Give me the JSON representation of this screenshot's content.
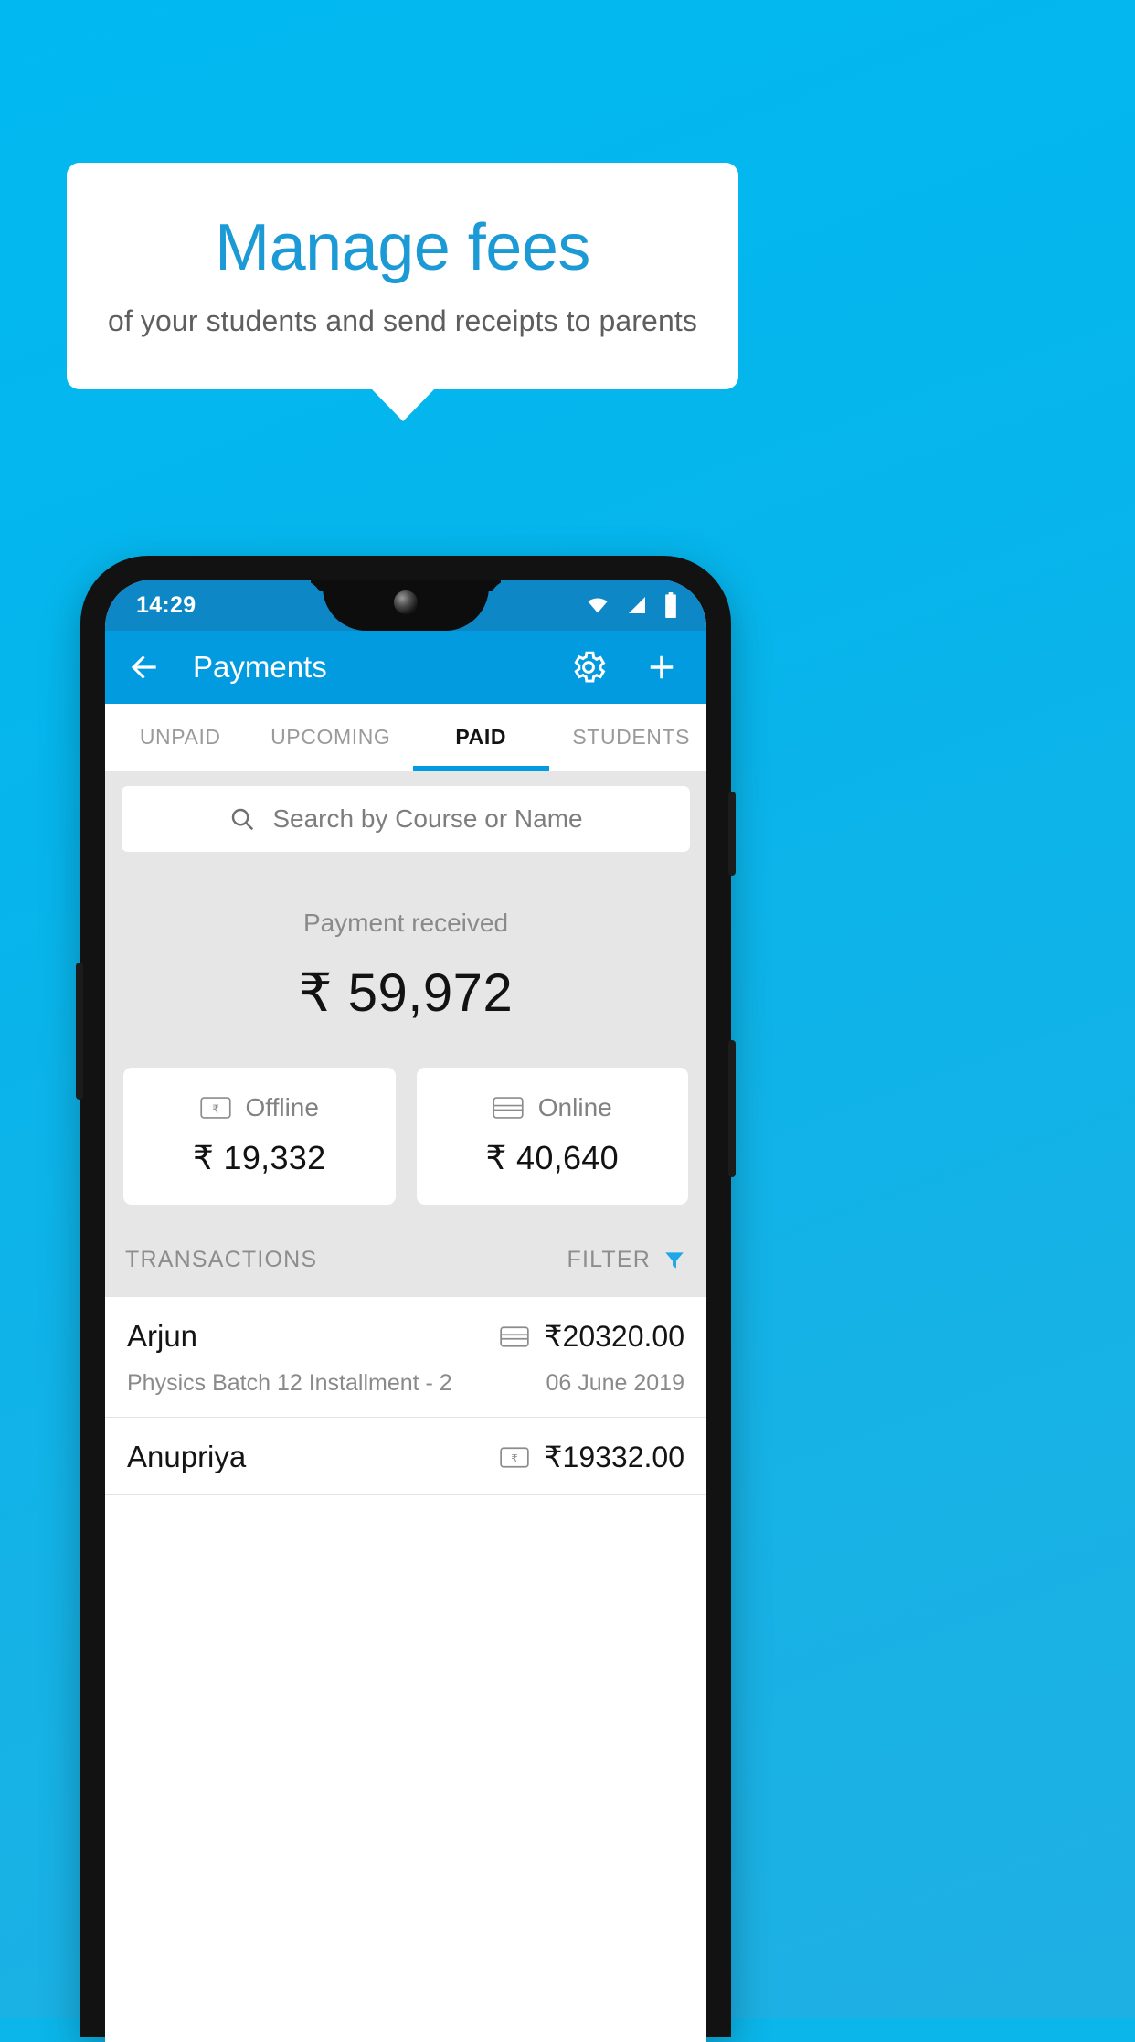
{
  "promo": {
    "title": "Manage fees",
    "subtitle": "of your students and send receipts to parents",
    "accent_color": "#1b9ad6",
    "background_color": "#0bb6ea"
  },
  "phone": {
    "status_bar": {
      "time": "14:29",
      "icons": [
        "wifi-icon",
        "cell-signal-icon",
        "battery-icon"
      ],
      "background_color": "#0d87c6"
    },
    "app_bar": {
      "back_label": "back-arrow-icon",
      "title": "Payments",
      "actions": [
        "settings-gear-icon",
        "add-plus-icon"
      ],
      "background_color": "#039BE0"
    },
    "tabs": {
      "items": [
        {
          "label": "UNPAID",
          "active": false
        },
        {
          "label": "UPCOMING",
          "active": false
        },
        {
          "label": "PAID",
          "active": true
        },
        {
          "label": "STUDENTS",
          "active": false
        }
      ],
      "indicator_color": "#039BE0"
    },
    "search": {
      "placeholder": "Search by Course or Name",
      "value": "",
      "icon": "search-icon"
    },
    "summary": {
      "label": "Payment received",
      "amount": "₹ 59,972"
    },
    "methods": [
      {
        "icon": "rupee-note-icon",
        "label": "Offline",
        "amount": "₹ 19,332"
      },
      {
        "icon": "credit-card-icon",
        "label": "Online",
        "amount": "₹ 40,640"
      }
    ],
    "list_header": {
      "title": "TRANSACTIONS",
      "filter_label": "FILTER",
      "filter_icon": "funnel-filter-icon",
      "filter_icon_color": "#1EA7E8"
    },
    "transactions": [
      {
        "name": "Arjun",
        "description": "Physics Batch 12 Installment - 2",
        "amount": "₹20320.00",
        "date": "06 June 2019",
        "method_icon": "credit-card-icon"
      },
      {
        "name": "Anupriya",
        "description": "",
        "amount": "₹19332.00",
        "date": "",
        "method_icon": "rupee-note-icon"
      }
    ]
  }
}
